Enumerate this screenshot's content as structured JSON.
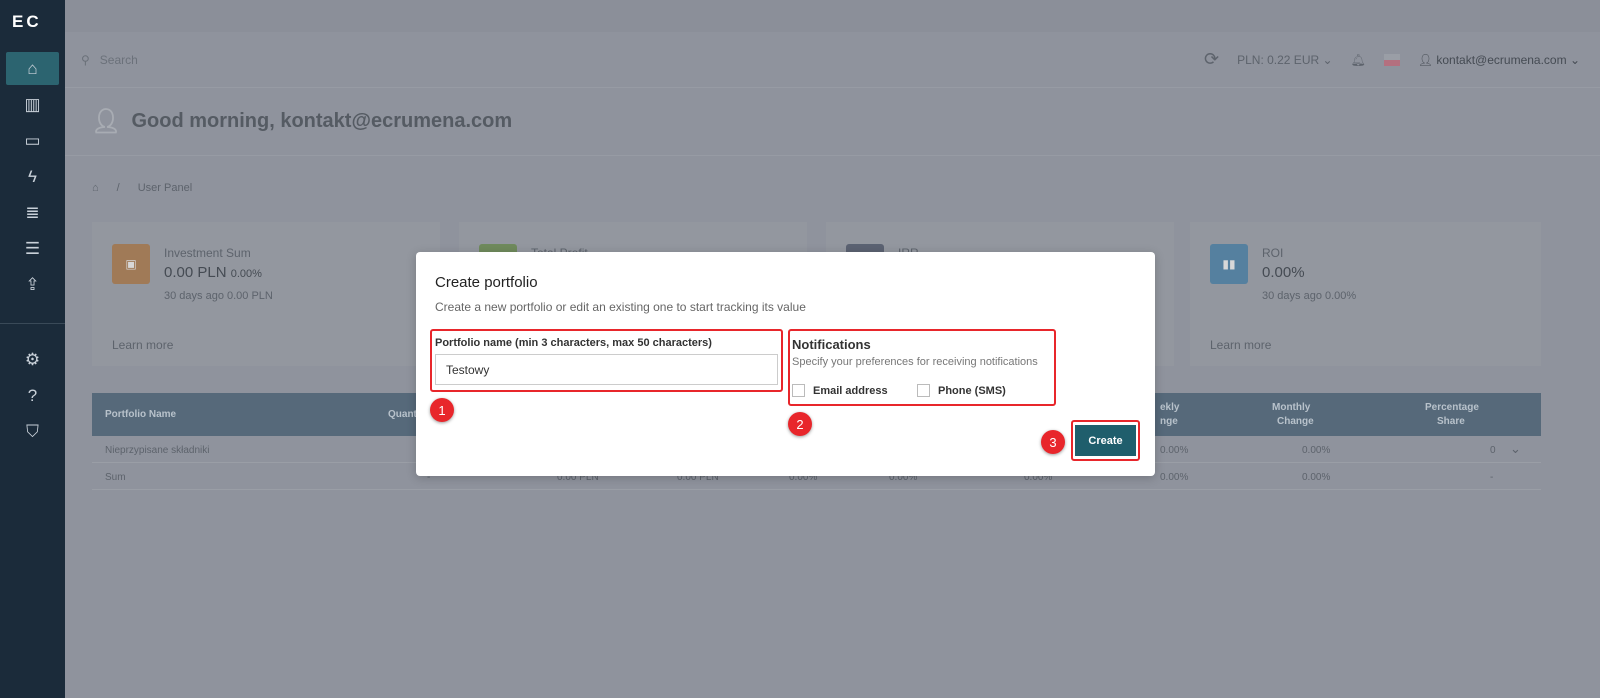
{
  "sidebar": {
    "logo": "EC",
    "items": [
      {
        "icon": "home-icon",
        "active": true
      },
      {
        "icon": "presentation-chart-icon"
      },
      {
        "icon": "wallet-icon"
      },
      {
        "icon": "lightning-icon"
      },
      {
        "icon": "stack-icon"
      },
      {
        "icon": "list-icon"
      },
      {
        "icon": "export-icon"
      },
      {
        "icon": "gear-icon"
      },
      {
        "icon": "help-icon"
      },
      {
        "icon": "shield-check-icon"
      }
    ]
  },
  "header": {
    "search_placeholder": "Search",
    "currency": "PLN: 0.22 EUR",
    "user": "kontakt@ecrumena.com"
  },
  "greeting": "Good morning, kontakt@ecrumena.com",
  "breadcrumb": {
    "sep": "/",
    "current": "User Panel"
  },
  "cards": [
    {
      "title": "Investment Sum",
      "value": "0.00 PLN",
      "pct": "0.00%",
      "sub": "30 days ago 0.00 PLN",
      "link": "Learn more",
      "color": "#a07a57"
    },
    {
      "title": "Total Profit",
      "color": "#6f8a5c"
    },
    {
      "title": "IRR",
      "color": "#5b6272"
    },
    {
      "title": "ROI",
      "value": "0.00%",
      "sub": "30 days ago 0.00%",
      "link": "Learn more",
      "color": "#55809f"
    }
  ],
  "table": {
    "headers": {
      "name": "Portfolio Name",
      "quantity": "Quant",
      "weekly": "Weekly Change",
      "weekly_visible": "ekly",
      "weekly_visible2": "nge",
      "monthly": "Monthly",
      "monthly2": "Change",
      "share": "Percentage",
      "share2": "Share"
    },
    "rows": [
      {
        "name": "Nieprzypisane składniki",
        "weekly": "0.00%",
        "monthly": "0.00%",
        "share": "0"
      },
      {
        "name": "Sum",
        "quantity": "-",
        "c1": "0.00 PLN",
        "c2": "0.00 PLN",
        "c3": "0.00%",
        "c4": "0.00%",
        "c5": "0.00%",
        "weekly": "0.00%",
        "monthly": "0.00%",
        "share": "-"
      }
    ]
  },
  "modal": {
    "title": "Create portfolio",
    "subtitle": "Create a new portfolio or edit an existing one to start tracking its value",
    "name_label": "Portfolio name (min 3 characters, max 50 characters)",
    "name_value": "Testowy",
    "notif_title": "Notifications",
    "notif_sub": "Specify your preferences for receiving notifications",
    "email": "Email address",
    "email_checked": false,
    "phone": "Phone (SMS)",
    "phone_checked": false,
    "create": "Create"
  },
  "annotations": [
    "1",
    "2",
    "3"
  ],
  "colors": {
    "highlight": "#e8262b",
    "primary": "#1f5e6c",
    "sidebar": "#1b2b3a"
  }
}
